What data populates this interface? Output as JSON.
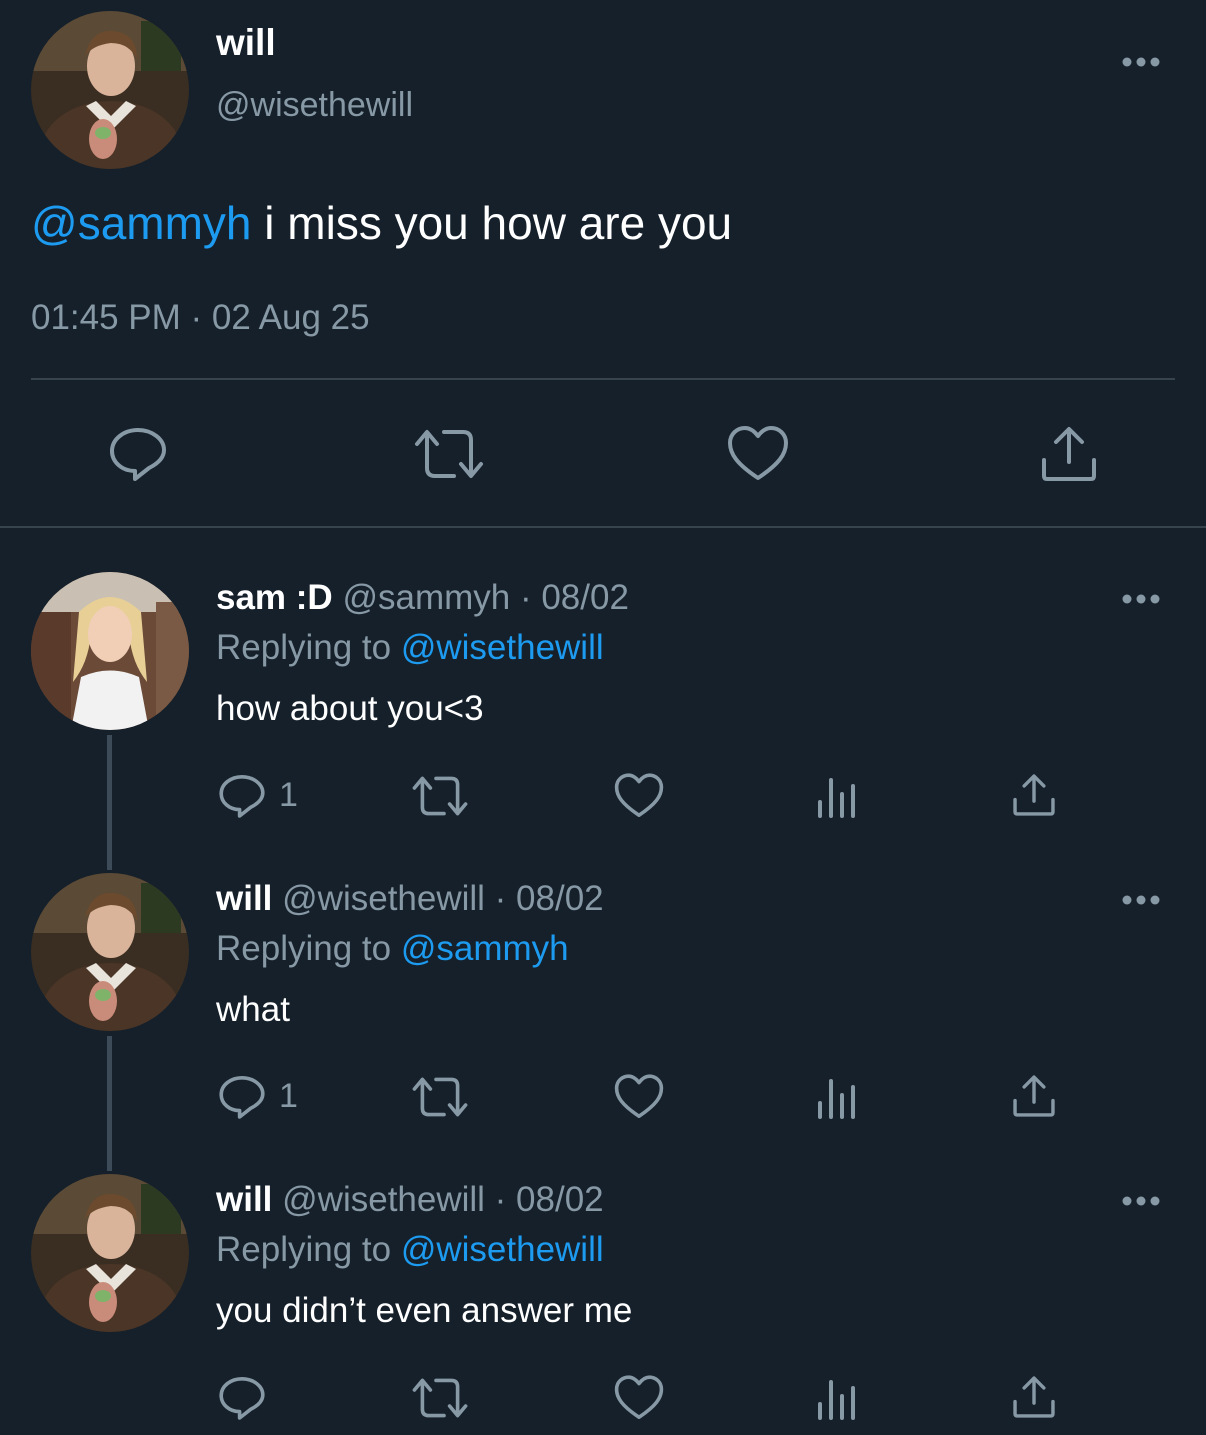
{
  "main_tweet": {
    "author_name": "will",
    "author_handle": "@wisethewill",
    "mention": "@sammyh",
    "text": " i miss you how are you",
    "timestamp": "01:45 PM · 02 Aug 25",
    "actions": [
      "reply-icon",
      "retweet-icon",
      "like-icon",
      "share-icon"
    ]
  },
  "replies": [
    {
      "author_name": "sam :D",
      "meta": "@sammyh · 08/02",
      "replying_prefix": "Replying to ",
      "replying_to": "@wisethewill",
      "text": "how about you<3",
      "reply_count": "1"
    },
    {
      "author_name": "will",
      "meta": "@wisethewill · 08/02",
      "replying_prefix": "Replying to ",
      "replying_to": "@sammyh",
      "text": "what",
      "reply_count": "1"
    },
    {
      "author_name": "will",
      "meta": "@wisethewill · 08/02",
      "replying_prefix": "Replying to ",
      "replying_to": "@wisethewill",
      "text": "you didn’t even answer me",
      "reply_count": ""
    }
  ],
  "colors": {
    "background": "#15202b",
    "accent": "#1d9bf0",
    "secondary_text": "#8899a6",
    "divider": "#38444d"
  }
}
